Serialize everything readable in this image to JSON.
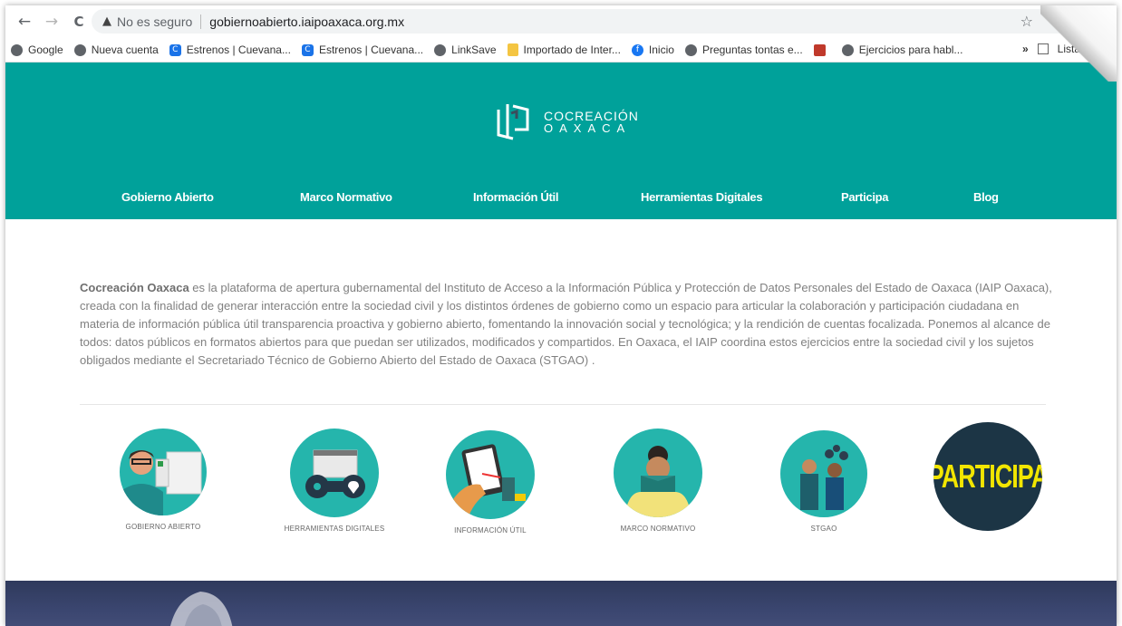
{
  "browser": {
    "nav": {
      "back": "←",
      "forward": "→",
      "reload": "C"
    },
    "warning_icon": "warning-triangle-icon",
    "not_secure": "No es seguro",
    "url": "gobiernoabierto.iaipoaxaca.org.mx",
    "star": "☆",
    "bookmarks": [
      {
        "label": "Google",
        "icon": "globe-icon"
      },
      {
        "label": "Nueva cuenta",
        "icon": "globe-icon"
      },
      {
        "label": "Estrenos | Cuevana...",
        "icon": "cuevana-icon"
      },
      {
        "label": "Estrenos | Cuevana...",
        "icon": "cuevana-icon"
      },
      {
        "label": "LinkSave",
        "icon": "globe-icon"
      },
      {
        "label": "Importado de Inter...",
        "icon": "folder-icon"
      },
      {
        "label": "Inicio",
        "icon": "facebook-icon"
      },
      {
        "label": "Preguntas tontas e...",
        "icon": "globe-icon"
      },
      {
        "label": "",
        "icon": "gift-icon"
      },
      {
        "label": "Ejercicios para habl...",
        "icon": "globe-icon"
      }
    ],
    "more": "»",
    "reading_list": "Lista"
  },
  "site": {
    "colors": {
      "brand": "#00a19a",
      "circle": "#25b5ac",
      "participa_bg": "#1c3545",
      "participa_text": "#f2e600"
    },
    "logo": {
      "line1": "COCREACIÓN",
      "line2": "OAXACA"
    },
    "nav": [
      "Gobierno Abierto",
      "Marco Normativo",
      "Información Útil",
      "Herramientas Digitales",
      "Participa",
      "Blog"
    ],
    "intro": {
      "brand": "Cocreación Oaxaca",
      "text": " es la plataforma de apertura gubernamental del Instituto de Acceso a la Información Pública y Protección de Datos Personales del Estado de Oaxaca (IAIP Oaxaca), creada con la finalidad de generar interacción entre la sociedad civil y los distintos órdenes de gobierno como un espacio para articular la colaboración y participación ciudadana en materia de información pública útil transparencia proactiva y gobierno abierto, fomentando la innovación social y tecnológica; y la rendición de cuentas focalizada. Ponemos al alcance de todos: datos públicos en formatos abiertos para que puedan ser utilizados, modificados y compartidos. En Oaxaca, el IAIP coordina estos ejercicios entre la sociedad civil y los sujetos obligados mediante el Secretariado Técnico de Gobierno Abierto del Estado de Oaxaca (STGAO) ."
    },
    "tiles": [
      {
        "label": "GOBIERNO ABIERTO"
      },
      {
        "label": "HERRAMIENTAS DIGITALES"
      },
      {
        "label": "INFORMACIÓN ÚTIL"
      },
      {
        "label": "MARCO NORMATIVO"
      },
      {
        "label": "STGAO"
      },
      {
        "label": "PARTICIPA"
      }
    ]
  }
}
